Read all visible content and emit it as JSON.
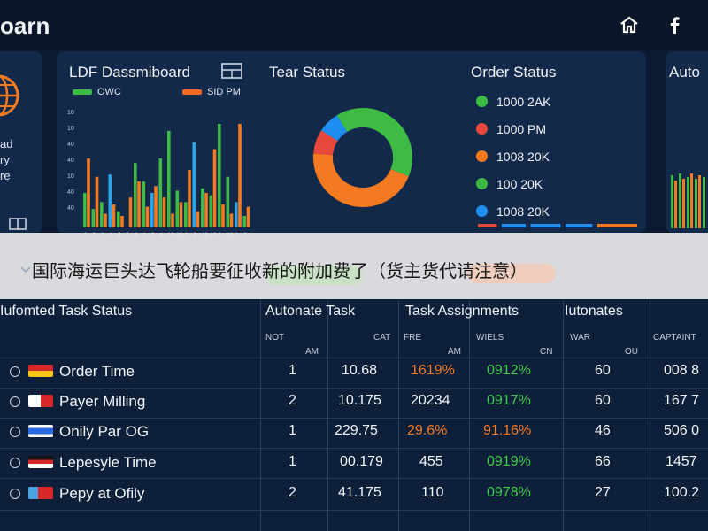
{
  "header": {
    "brand": "oarn",
    "home_icon": "home-icon",
    "social_icon": "facebook-icon"
  },
  "left_panel": {
    "lines": [
      "ad",
      "ry",
      "re"
    ],
    "globe_icon": "globe-icon",
    "expand_icon": "expand-icon"
  },
  "main_panel": {
    "title": "LDF Dassmiboard",
    "title_icon": "layout-icon",
    "legend": [
      {
        "label": "OWC",
        "color": "#3dbb45"
      },
      {
        "label": "SID PM",
        "color": "#f46a22"
      }
    ],
    "y_ticks": [
      "40",
      "40",
      "10",
      "40",
      "40",
      "10",
      "10"
    ],
    "x_ticks": [
      "0",
      "0",
      "2",
      "4",
      "5",
      "5",
      "9",
      "1",
      "0",
      "4",
      "10",
      "20",
      "2",
      "9",
      "10",
      "10",
      "1",
      "10",
      "1",
      "3"
    ],
    "tear_title": "Tear Status",
    "order_title": "Order Status",
    "order_status": [
      {
        "label": "1000 2AK",
        "color": "#3dbb45"
      },
      {
        "label": "1000 PM",
        "color": "#e8483a"
      },
      {
        "label": "1008 20K",
        "color": "#f47a22"
      },
      {
        "label": "100 20K",
        "color": "#3dbb45"
      },
      {
        "label": "1008 20K",
        "color": "#1e8ff0"
      }
    ]
  },
  "right_panel": {
    "title": "Auto"
  },
  "banner": {
    "text": "国际海运巨头达飞轮船要征收新的附加费了（货主货代请注意）"
  },
  "table": {
    "title": "Iufomted Task Status",
    "columns": [
      "Autonate Task",
      "Task Assignments",
      "Iutonates"
    ],
    "sub_headers": [
      "NOT",
      "AM",
      "CAT",
      "FRE",
      "AM",
      "WIELS",
      "CN",
      "WAR",
      "OU",
      "CAPTAINT"
    ],
    "rows": [
      {
        "name": "Order Time",
        "c1": "1",
        "c2": "10.68",
        "c3": "1619%",
        "c4": "0912%",
        "c5": "60",
        "c6": "008 8"
      },
      {
        "name": "Payer Milling",
        "c1": "2",
        "c2": "10.175",
        "c3": "20234",
        "c4": "0917%",
        "c5": "60",
        "c6": "167 7"
      },
      {
        "name": "Onily Par OG",
        "c1": "1",
        "c2": "229.75",
        "c3": "29.6%",
        "c4": "91.16%",
        "c5": "46",
        "c6": "506 0"
      },
      {
        "name": "Lepesyle Time",
        "c1": "1",
        "c2": "00.179",
        "c3": "455",
        "c4": "0919%",
        "c5": "66",
        "c6": "1457"
      },
      {
        "name": "Pepy at Ofily",
        "c1": "2",
        "c2": "41.175",
        "c3": "110",
        "c4": "0978%",
        "c5": "27",
        "c6": "100.2"
      }
    ]
  },
  "chart_data": {
    "type": "bar",
    "categories": [
      "1",
      "2",
      "3",
      "4",
      "5",
      "6",
      "7",
      "8",
      "9",
      "10",
      "11",
      "12",
      "13",
      "14",
      "15",
      "16",
      "17",
      "18",
      "19",
      "20"
    ],
    "series": [
      {
        "name": "OWC",
        "values": [
          30,
          16,
          22,
          46,
          14,
          0,
          56,
          40,
          30,
          60,
          84,
          32,
          22,
          74,
          34,
          28,
          90,
          44,
          22,
          10
        ]
      },
      {
        "name": "SID PM",
        "values": [
          60,
          44,
          12,
          20,
          10,
          26,
          40,
          18,
          36,
          26,
          12,
          22,
          50,
          14,
          30,
          68,
          20,
          12,
          90,
          18
        ]
      }
    ],
    "donut": [
      {
        "label": "green",
        "value": 40,
        "color": "#3dbb45"
      },
      {
        "label": "orange",
        "value": 45,
        "color": "#f47a22"
      },
      {
        "label": "red",
        "value": 8,
        "color": "#e8483a"
      },
      {
        "label": "blue",
        "value": 7,
        "color": "#1e8ff0"
      }
    ]
  }
}
